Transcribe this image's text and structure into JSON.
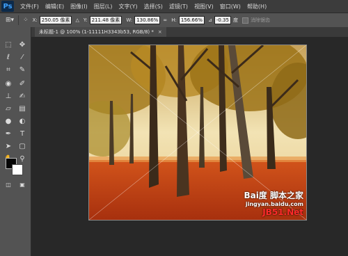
{
  "app": {
    "logo": "Ps"
  },
  "menu": [
    "文件(F)",
    "编辑(E)",
    "图像(I)",
    "图层(L)",
    "文字(Y)",
    "选择(S)",
    "滤镜(T)",
    "视图(V)",
    "窗口(W)",
    "帮助(H)"
  ],
  "options": {
    "x_label": "X:",
    "x_value": "250.05 像素",
    "y_label": "Y:",
    "y_value": "211.48 像素",
    "w_label": "W:",
    "w_value": "130.86%",
    "h_label": "H:",
    "h_value": "156.66%",
    "angle_value": "-0.35",
    "angle_unit": "度",
    "interp_label": "消除锯齿"
  },
  "document_tab": {
    "title": "未标题-1 @ 100% (1-11111H3343b53, RGB/8) *",
    "close": "×"
  },
  "tools": [
    {
      "icon": "marquee-icon"
    },
    {
      "icon": "move-icon"
    },
    {
      "icon": "lasso-icon"
    },
    {
      "icon": "magic-wand-icon"
    },
    {
      "icon": "crop-icon"
    },
    {
      "icon": "eyedropper-icon"
    },
    {
      "icon": "healing-brush-icon"
    },
    {
      "icon": "brush-icon"
    },
    {
      "icon": "clone-stamp-icon"
    },
    {
      "icon": "history-brush-icon"
    },
    {
      "icon": "eraser-icon"
    },
    {
      "icon": "gradient-icon"
    },
    {
      "icon": "blur-icon"
    },
    {
      "icon": "dodge-icon"
    },
    {
      "icon": "pen-icon"
    },
    {
      "icon": "type-icon"
    },
    {
      "icon": "path-select-icon"
    },
    {
      "icon": "shape-icon"
    },
    {
      "icon": "hand-icon"
    },
    {
      "icon": "zoom-icon"
    }
  ],
  "colors": {
    "foreground": "#050505",
    "background": "#ffffff",
    "accent": "#3fa2ff"
  },
  "watermark": {
    "line1": "Bai度 脚本之家",
    "line2": "jingyan.baidu.com",
    "line3": "JB51.Net"
  }
}
